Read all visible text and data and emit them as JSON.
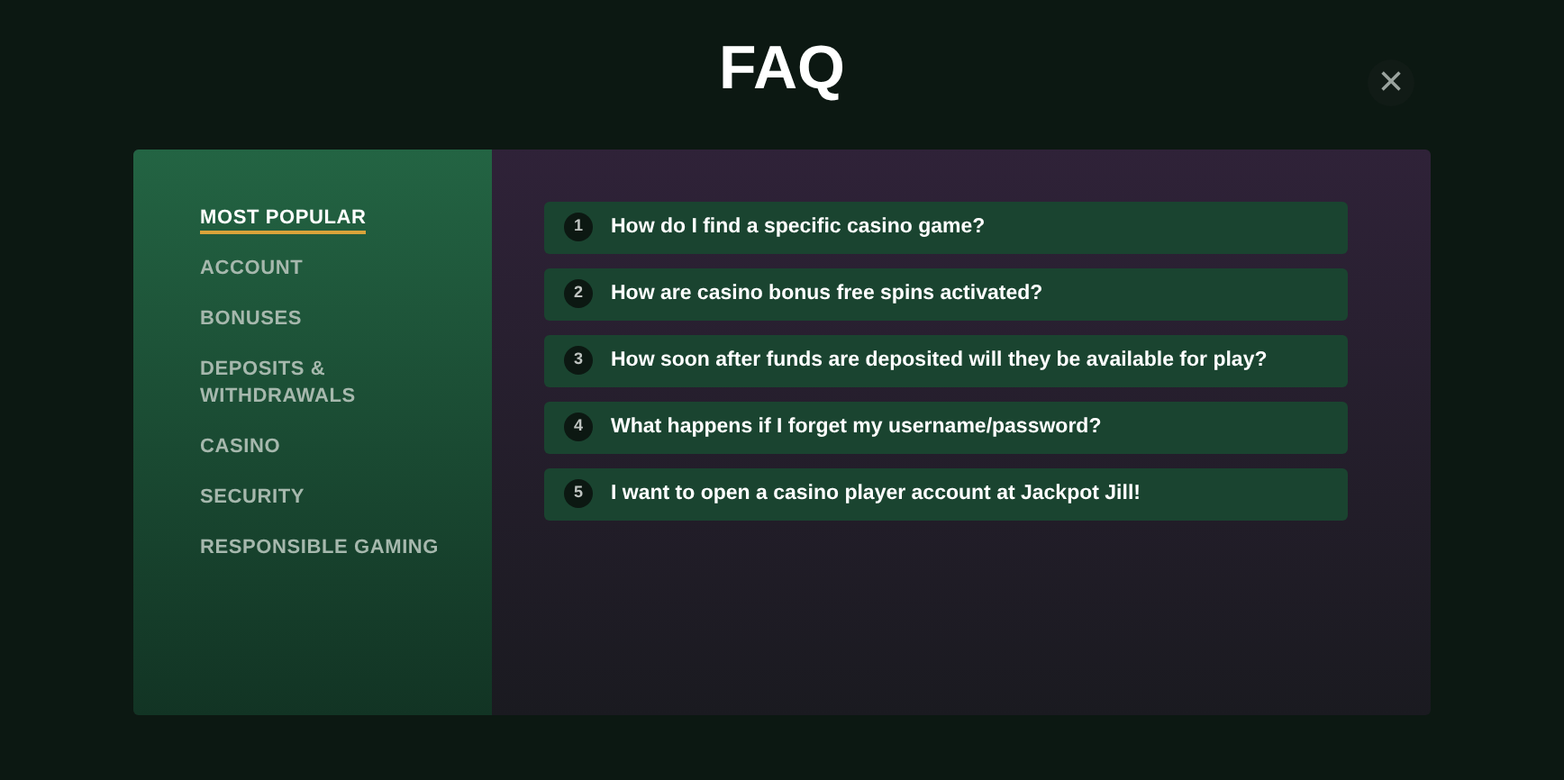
{
  "title": "FAQ",
  "close": {
    "label": "×"
  },
  "categories": [
    {
      "label": "MOST POPULAR",
      "selected": true
    },
    {
      "label": "ACCOUNT",
      "selected": false
    },
    {
      "label": "BONUSES",
      "selected": false
    },
    {
      "label": "DEPOSITS & WITHDRAWALS",
      "selected": false
    },
    {
      "label": "CASINO",
      "selected": false
    },
    {
      "label": "SECURITY",
      "selected": false
    },
    {
      "label": "RESPONSIBLE GAMING",
      "selected": false
    }
  ],
  "questions": [
    {
      "number": "1",
      "text": "How do I find a specific casino game?"
    },
    {
      "number": "2",
      "text": "How are casino bonus free spins activated?"
    },
    {
      "number": "3",
      "text": "How soon after funds are deposited will they be available for play?"
    },
    {
      "number": "4",
      "text": "What happens if I forget my username/password?"
    },
    {
      "number": "5",
      "text": "I want to open a casino player account at Jackpot Jill!"
    }
  ]
}
